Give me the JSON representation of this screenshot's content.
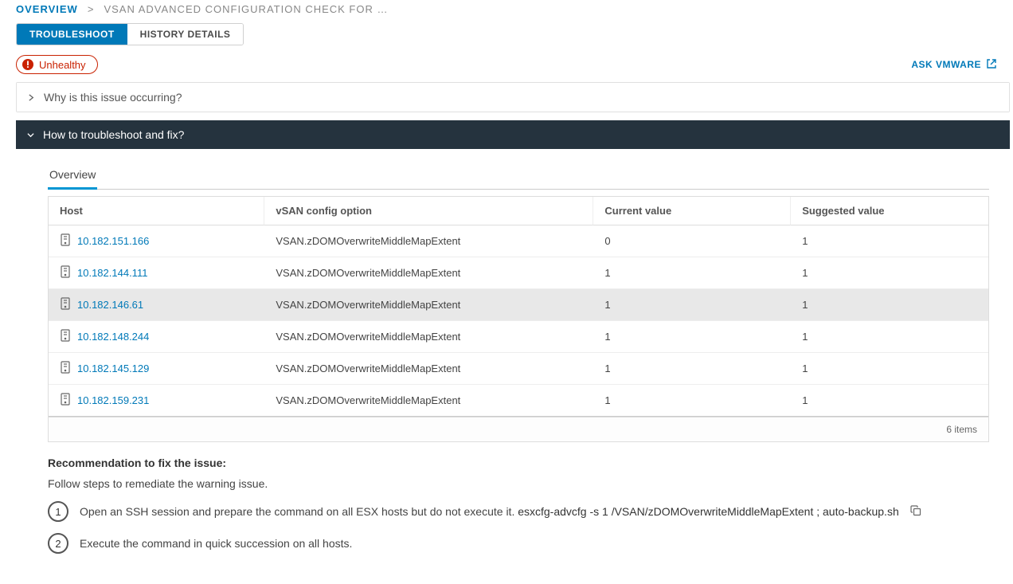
{
  "breadcrumb": {
    "overview": "OVERVIEW",
    "sep": ">",
    "current": "VSAN ADVANCED CONFIGURATION CHECK FOR …"
  },
  "tabs": {
    "troubleshoot": "TROUBLESHOOT",
    "history": "HISTORY DETAILS"
  },
  "status": {
    "label": "Unhealthy"
  },
  "ask_vmware": "ASK VMWARE",
  "panels": {
    "why": "Why is this issue occurring?",
    "how": "How to troubleshoot and fix?"
  },
  "subtab": "Overview",
  "table": {
    "headers": {
      "host": "Host",
      "option": "vSAN config option",
      "current": "Current value",
      "suggested": "Suggested value"
    },
    "rows": [
      {
        "host": "10.182.151.166",
        "option": "VSAN.zDOMOverwriteMiddleMapExtent",
        "current": "0",
        "suggested": "1",
        "selected": false
      },
      {
        "host": "10.182.144.111",
        "option": "VSAN.zDOMOverwriteMiddleMapExtent",
        "current": "1",
        "suggested": "1",
        "selected": false
      },
      {
        "host": "10.182.146.61",
        "option": "VSAN.zDOMOverwriteMiddleMapExtent",
        "current": "1",
        "suggested": "1",
        "selected": true
      },
      {
        "host": "10.182.148.244",
        "option": "VSAN.zDOMOverwriteMiddleMapExtent",
        "current": "1",
        "suggested": "1",
        "selected": false
      },
      {
        "host": "10.182.145.129",
        "option": "VSAN.zDOMOverwriteMiddleMapExtent",
        "current": "1",
        "suggested": "1",
        "selected": false
      },
      {
        "host": "10.182.159.231",
        "option": "VSAN.zDOMOverwriteMiddleMapExtent",
        "current": "1",
        "suggested": "1",
        "selected": false
      }
    ],
    "footer": "6 items"
  },
  "reco": {
    "title": "Recommendation to fix the issue:",
    "sub": "Follow steps to remediate the warning issue.",
    "steps": [
      {
        "num": "1",
        "text": "Open an SSH session and prepare the command on all ESX hosts but do not execute it.  ",
        "cmd": "esxcfg-advcfg -s 1 /VSAN/zDOMOverwriteMiddleMapExtent ; auto-backup.sh",
        "copyable": true
      },
      {
        "num": "2",
        "text": "Execute the command in quick succession on all hosts.",
        "cmd": "",
        "copyable": false
      }
    ]
  }
}
